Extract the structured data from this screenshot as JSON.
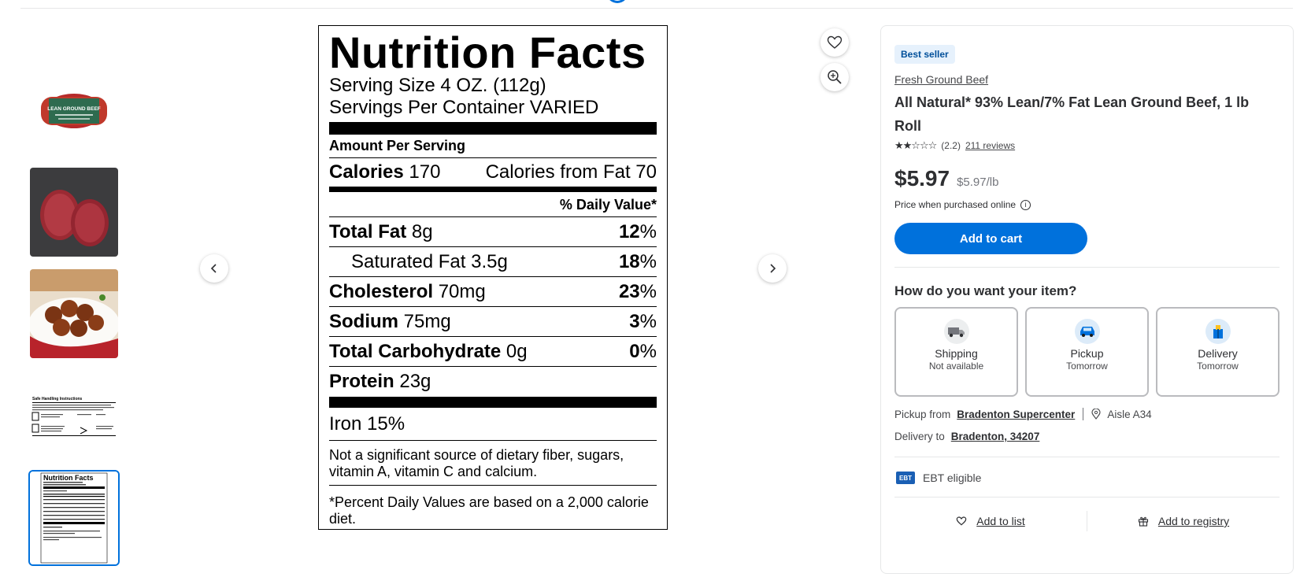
{
  "thumbnails": [
    {
      "name": "ground-beef-package",
      "label": "LEAN GROUND BEEF"
    },
    {
      "name": "raw-ground-beef-rolls"
    },
    {
      "name": "meatballs-dish"
    },
    {
      "name": "safe-handling-instructions",
      "label": "Safe Handling Instructions"
    },
    {
      "name": "nutrition-facts-thumb",
      "label": "Nutrition Facts"
    }
  ],
  "nutrition": {
    "title": "Nutrition Facts",
    "serving_size": "Serving Size 4 OZ. (112g)",
    "servings_per_container": "Servings Per Container VARIED",
    "amount_per_serving": "Amount Per Serving",
    "calories_label": "Calories",
    "calories_value": "170",
    "calories_from_fat": "Calories from Fat 70",
    "daily_value_header": "% Daily Value*",
    "rows": [
      {
        "label": "Total Fat",
        "amount": "8g",
        "pct": "12",
        "indent": false
      },
      {
        "label": "Saturated Fat",
        "amount": "3.5g",
        "pct": "18",
        "indent": true
      },
      {
        "label": "Cholesterol",
        "amount": "70mg",
        "pct": "23",
        "indent": false
      },
      {
        "label": "Sodium",
        "amount": "75mg",
        "pct": "3",
        "indent": false
      },
      {
        "label": "Total Carbohydrate",
        "amount": "0g",
        "pct": "0",
        "indent": false
      },
      {
        "label": "Protein",
        "amount": "23g",
        "pct": "",
        "indent": false
      }
    ],
    "iron": "Iron 15%",
    "note": "Not a significant source of dietary fiber, sugars, vitamin A, vitamin C and calcium.",
    "footnote": "*Percent Daily Values are based on a 2,000 calorie diet."
  },
  "product": {
    "badge": "Best seller",
    "brand": "Fresh Ground Beef",
    "title": "All Natural* 93% Lean/7% Fat Lean Ground Beef, 1 lb Roll",
    "stars": "★★☆☆☆",
    "rating": "(2.2)",
    "reviews": "211 reviews",
    "price": "$5.97",
    "unit_price": "$5.97/lb",
    "price_note": "Price when purchased online",
    "add_to_cart": "Add to cart",
    "fulfillment_heading": "How do you want your item?",
    "options": [
      {
        "label": "Shipping",
        "sub": "Not available"
      },
      {
        "label": "Pickup",
        "sub": "Tomorrow"
      },
      {
        "label": "Delivery",
        "sub": "Tomorrow"
      }
    ],
    "pickup_prefix": "Pickup from",
    "pickup_store": "Bradenton Supercenter",
    "aisle": "Aisle A34",
    "delivery_prefix": "Delivery to",
    "delivery_location": "Bradenton, 34207",
    "ebt_badge": "EBT",
    "ebt_text": "EBT eligible",
    "add_to_list": "Add to list",
    "add_to_registry": "Add to registry"
  },
  "colors": {
    "primary": "#0071dc",
    "badge_bg": "#e6f1fc",
    "badge_text": "#004f9a"
  }
}
